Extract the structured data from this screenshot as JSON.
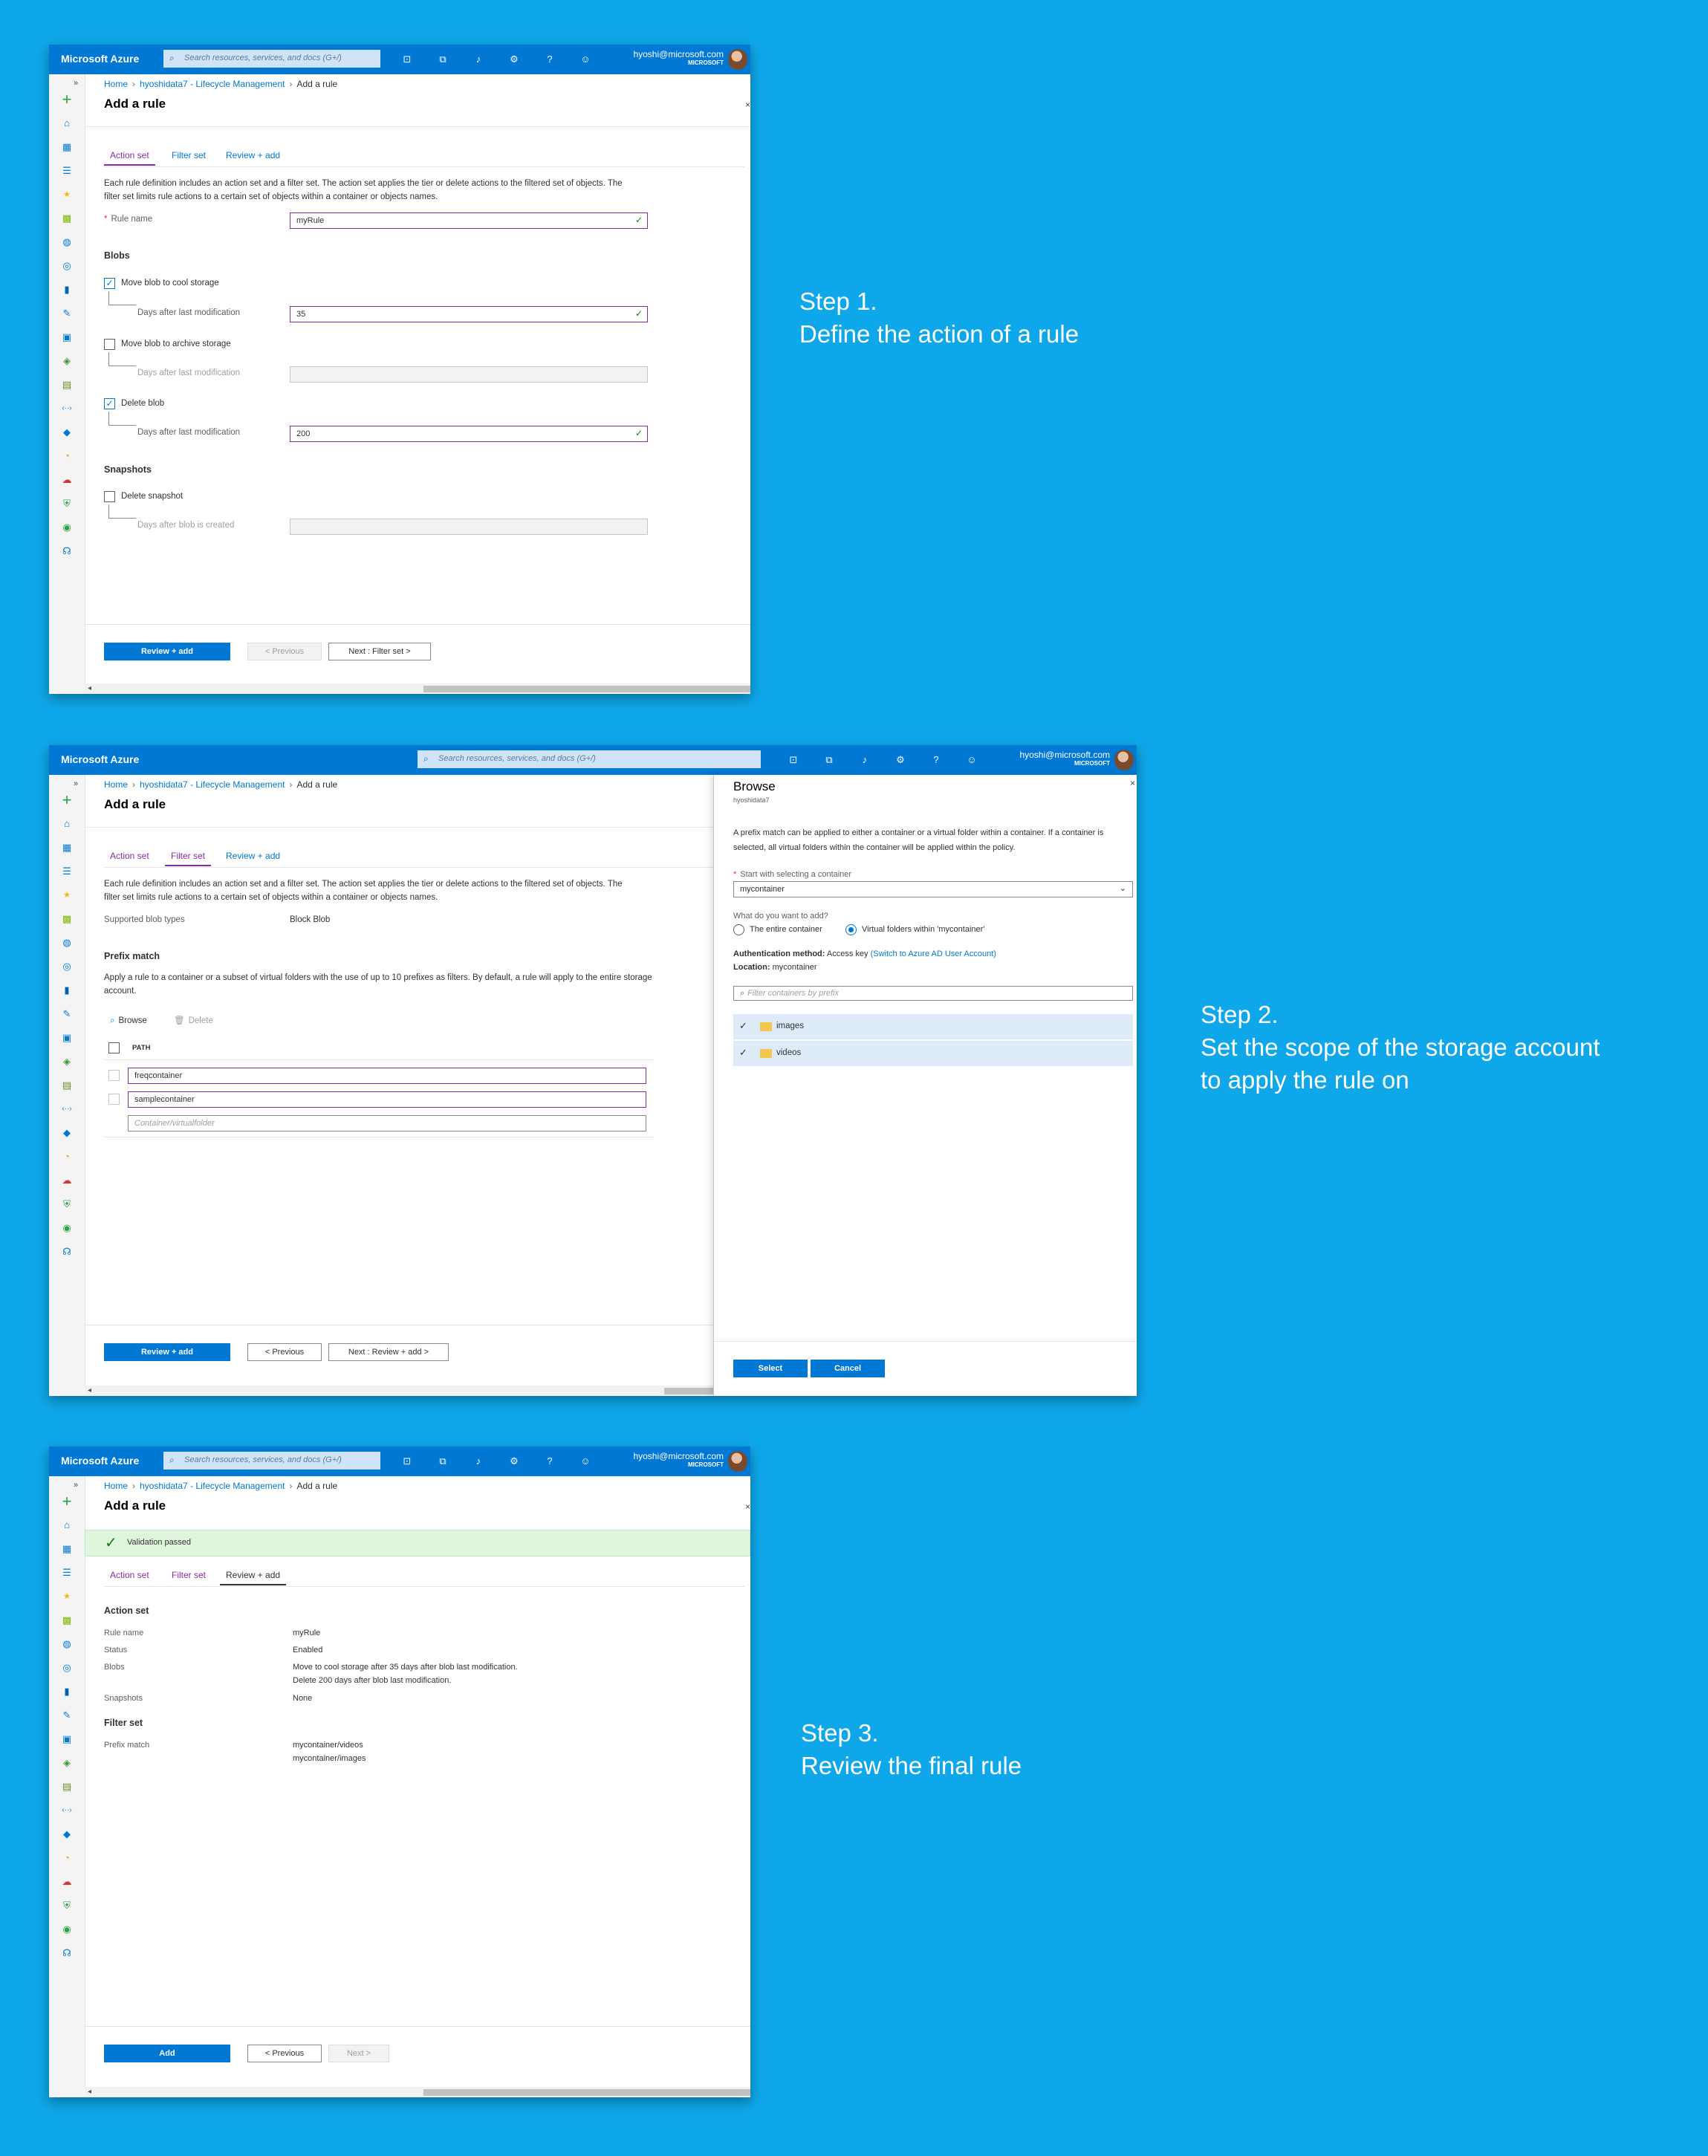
{
  "common": {
    "brand": "Microsoft Azure",
    "search_placeholder": "Search resources, services, and docs (G+/)",
    "user_email": "hyoshi@microsoft.com",
    "user_org": "MICROSOFT",
    "breadcrumb": [
      "Home",
      "hyoshidata7 - Lifecycle Management",
      "Add a rule"
    ],
    "page_title": "Add a rule",
    "tabs": [
      "Action set",
      "Filter set",
      "Review + add"
    ],
    "intro": "Each rule definition includes an action set and a filter set. The action set applies the tier or delete actions to the filtered set of objects. The filter set limits rule actions to a certain set of objects within a container or objects names.",
    "rail_expand": "»",
    "close": "×"
  },
  "steps": [
    {
      "line1": "Step 1.",
      "line2": "Define the action of a rule",
      "line3": ""
    },
    {
      "line1": "Step 2.",
      "line2": "Set the scope of the storage account",
      "line3": "to apply the rule on"
    },
    {
      "line1": "Step 3.",
      "line2": "Review the final rule",
      "line3": ""
    }
  ],
  "step1": {
    "rule_name_label": "Rule name",
    "rule_name_value": "myRule",
    "blobs_heading": "Blobs",
    "move_cool_label": "Move blob to cool storage",
    "move_cool_checked": true,
    "days_label": "Days after last modification",
    "cool_days": "35",
    "move_archive_label": "Move blob to archive storage",
    "move_archive_checked": false,
    "delete_blob_label": "Delete blob",
    "delete_blob_checked": true,
    "delete_days": "200",
    "snapshots_heading": "Snapshots",
    "delete_snapshot_label": "Delete snapshot",
    "delete_snapshot_checked": false,
    "days_after_created_label": "Days after blob is created",
    "buttons": {
      "primary": "Review + add",
      "previous": "< Previous",
      "next": "Next : Filter set >"
    }
  },
  "step2": {
    "supported_label": "Supported blob types",
    "supported_value": "Block Blob",
    "prefix_heading": "Prefix match",
    "prefix_desc": "Apply a rule to a container or a subset of virtual folders with the use of up to 10 prefixes as filters. By default, a rule will apply to the entire storage account.",
    "browse_label": "Browse",
    "delete_label": "Delete",
    "path_header": "PATH",
    "paths": [
      "freqcontainer",
      "samplecontainer"
    ],
    "path_placeholder": "Container/virtualfolder",
    "buttons": {
      "primary": "Review + add",
      "previous": "< Previous",
      "next": "Next : Review + add >"
    },
    "browse_panel": {
      "title": "Browse",
      "subtitle": "hyoshidata7",
      "desc": "A prefix match can be applied to either a container or a virtual folder within a container. If a container is selected, all virtual folders within the container will be applied within the policy.",
      "start_label": "Start with selecting a container",
      "container_value": "mycontainer",
      "question": "What do you want to add?",
      "option_entire": "The entire container",
      "option_folders": "Virtual folders within 'mycontainer'",
      "selected_option": "folders",
      "auth_label": "Authentication method:",
      "auth_value": "Access key",
      "auth_link": "(Switch to Azure AD User Account)",
      "location_label": "Location:",
      "location_value": "mycontainer",
      "filter_placeholder": "Filter containers by prefix",
      "folders": [
        "images",
        "videos"
      ],
      "select_button": "Select",
      "cancel_button": "Cancel"
    }
  },
  "step3": {
    "validation": "Validation passed",
    "action_heading": "Action set",
    "rows": [
      {
        "label": "Rule name",
        "value": "myRule",
        "value2": ""
      },
      {
        "label": "Status",
        "value": "Enabled",
        "value2": ""
      },
      {
        "label": "Blobs",
        "value": "Move to cool storage after 35 days after blob last modification.",
        "value2": "Delete 200 days after blob last modification."
      },
      {
        "label": "Snapshots",
        "value": "None",
        "value2": ""
      }
    ],
    "filter_heading": "Filter set",
    "prefix_label": "Prefix match",
    "prefix_values": [
      "mycontainer/videos",
      "mycontainer/images"
    ],
    "buttons": {
      "primary": "Add",
      "previous": "< Previous",
      "next": "Next >"
    }
  },
  "colors": {
    "background": "#0ea7e9",
    "azure_blue": "#0078d4",
    "tab_purple": "#8a2da5",
    "success_green": "#107c10"
  },
  "rail_icons": [
    "create-resource-icon",
    "home-icon",
    "dashboard-icon",
    "all-services-icon",
    "favorites-star-icon",
    "all-resources-icon",
    "resource-groups-icon",
    "app-services-icon",
    "sql-databases-icon",
    "cosmos-db-icon",
    "virtual-machines-icon",
    "load-balancers-icon",
    "storage-accounts-icon",
    "virtual-networks-icon",
    "azure-ad-icon",
    "monitor-icon",
    "advisor-icon",
    "security-center-icon",
    "cost-management-icon",
    "help-support-icon"
  ]
}
